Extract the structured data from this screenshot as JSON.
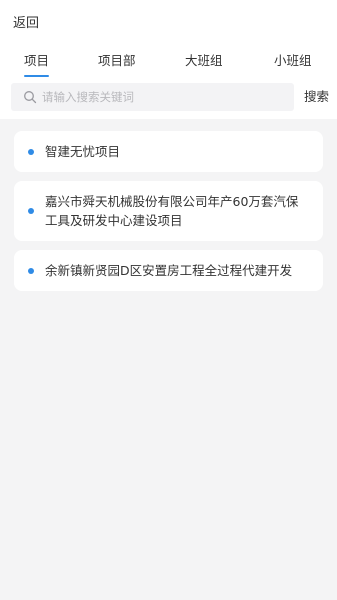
{
  "header": {
    "back_label": "返回"
  },
  "tabs": [
    {
      "label": "项目"
    },
    {
      "label": "项目部"
    },
    {
      "label": "大班组"
    },
    {
      "label": "小班组"
    }
  ],
  "search": {
    "placeholder": "请输入搜索关键词",
    "value": "",
    "button_label": "搜索"
  },
  "projects": [
    {
      "name": "智建无忧项目"
    },
    {
      "name": "嘉兴市舜天机械股份有限公司年产60万套汽保工具及研发中心建设项目"
    },
    {
      "name": "余新镇新贤园D区安置房工程全过程代建开发"
    }
  ],
  "colors": {
    "accent": "#2f8be6",
    "background": "#f4f4f5"
  }
}
